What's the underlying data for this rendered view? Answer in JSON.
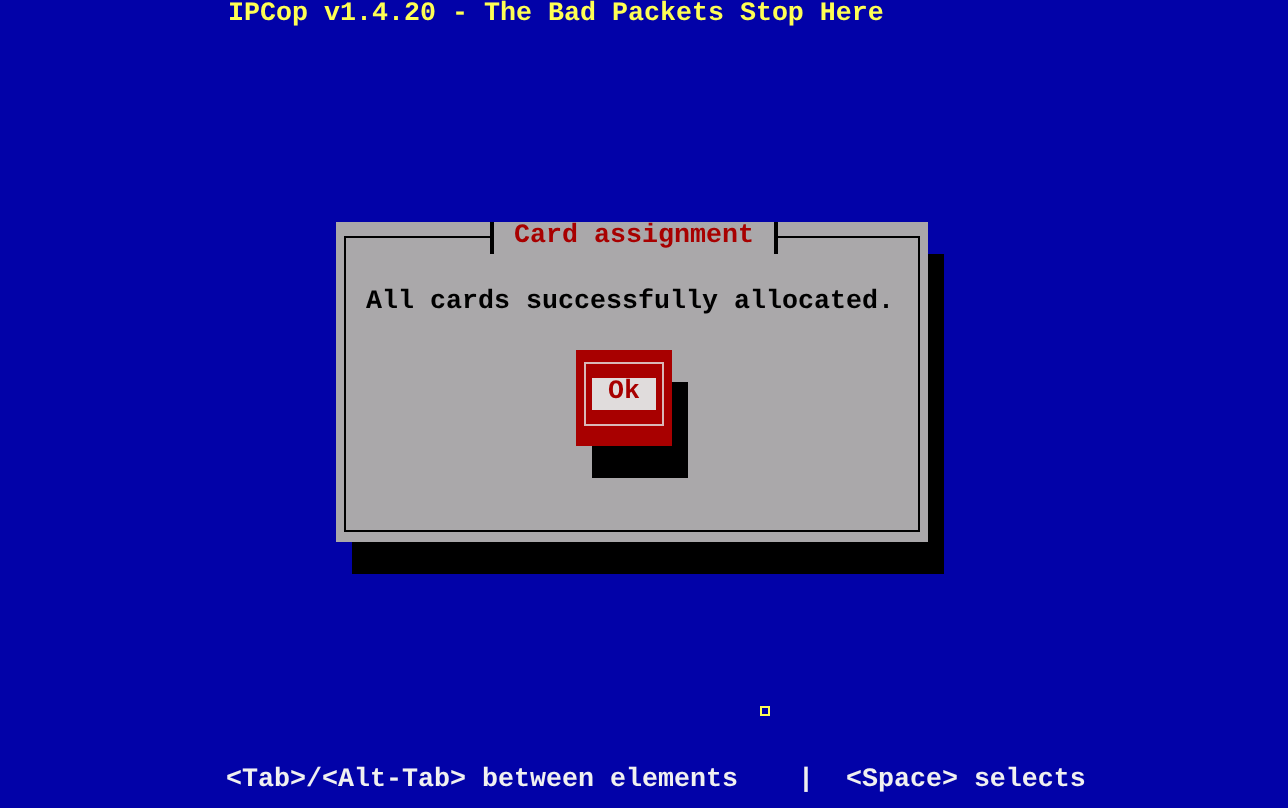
{
  "header": {
    "title": "IPCop v1.4.20 - The Bad Packets Stop Here"
  },
  "dialog": {
    "title": "Card assignment",
    "message": "All cards successfully allocated.",
    "buttons": [
      {
        "label": "Ok",
        "selected": true
      }
    ]
  },
  "status_bar": [
    "<Tab>/<Alt-Tab> between elements",
    "|",
    "<Space> selects"
  ]
}
